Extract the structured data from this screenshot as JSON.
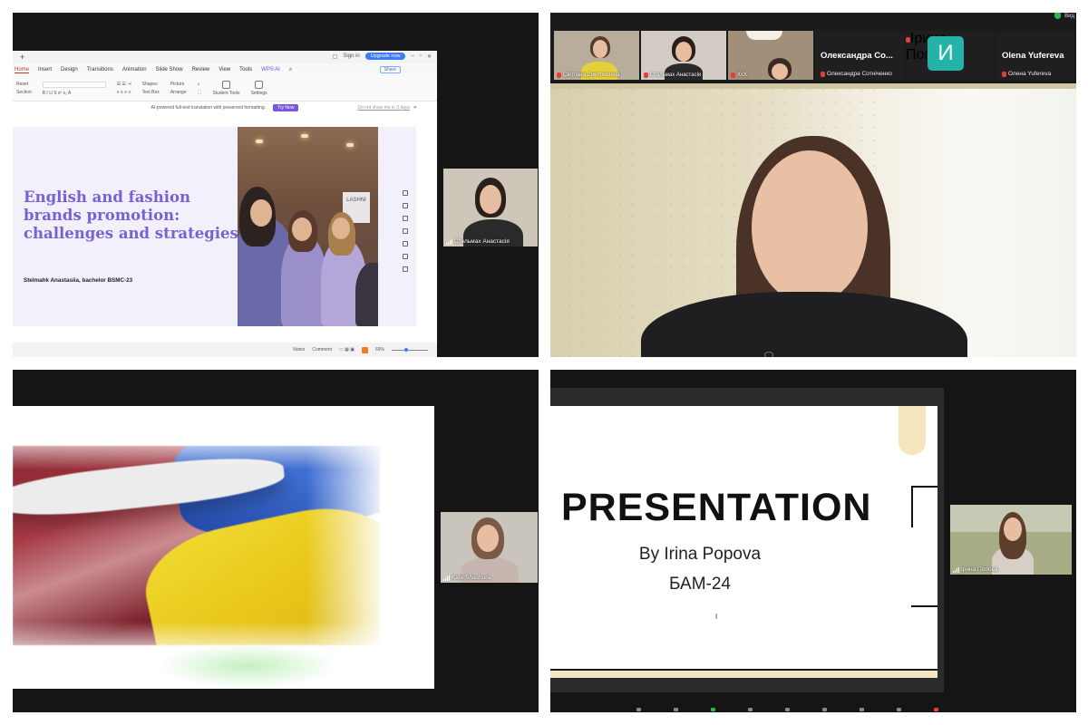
{
  "panel1": {
    "wps": {
      "signin": "Sign in",
      "upgrade": "Upgrade now",
      "tabs": [
        "Home",
        "Insert",
        "Design",
        "Transitions",
        "Animation",
        "Slide Show",
        "Review",
        "View",
        "Tools"
      ],
      "wps_ai": "WPS AI",
      "share": "Share",
      "ribbon": {
        "reset": "Reset",
        "section": "Section",
        "shapes": "Shapes",
        "picture": "Picture",
        "textbox": "Text Box",
        "arrange": "Arrange",
        "student_tools": "Student Tools",
        "settings": "Settings"
      },
      "banner_text": "AI-powered full-text translation with preserved formatting.",
      "try_now": "Try Now",
      "dont_show": "Do not show me in 3 days",
      "status": {
        "notes": "Notes",
        "comment": "Comment",
        "zoom": "69%"
      }
    },
    "slide": {
      "title": "English and fashion brands promotion: challenges and strategies",
      "author": "Stelmahk Anastasiia, bachelor BSMC-23",
      "photo_sign": "LASHNI"
    },
    "participant": "Стельмах Анастасія"
  },
  "panel2": {
    "thumbs": [
      {
        "name": "Світлана Дмитришина"
      },
      {
        "name": "Стельмах Анастасія"
      },
      {
        "name": "XxX"
      }
    ],
    "name_tile_1": {
      "big": "Олександра Со...",
      "small": "Олександра Сотніченко"
    },
    "avatar": {
      "letter": "И",
      "name": "Ірина Попова"
    },
    "name_tile_2": {
      "big": "Olena Yufereva",
      "small": "Олена Yufereva"
    },
    "view_label": "Вид"
  },
  "panel3": {
    "participant": "Kate Shashura"
  },
  "panel4": {
    "slide": {
      "title": "PRESENTATION",
      "by": "By Irina Popova",
      "group": "БАМ-24",
      "cursor": "I"
    },
    "participant": "Ірина Попова"
  },
  "colors": {
    "slide_title_purple": "#7860d6",
    "avatar_teal": "#25b2a8",
    "mic_off_red": "#e0403a",
    "pill_beige": "#f5e6c0"
  }
}
